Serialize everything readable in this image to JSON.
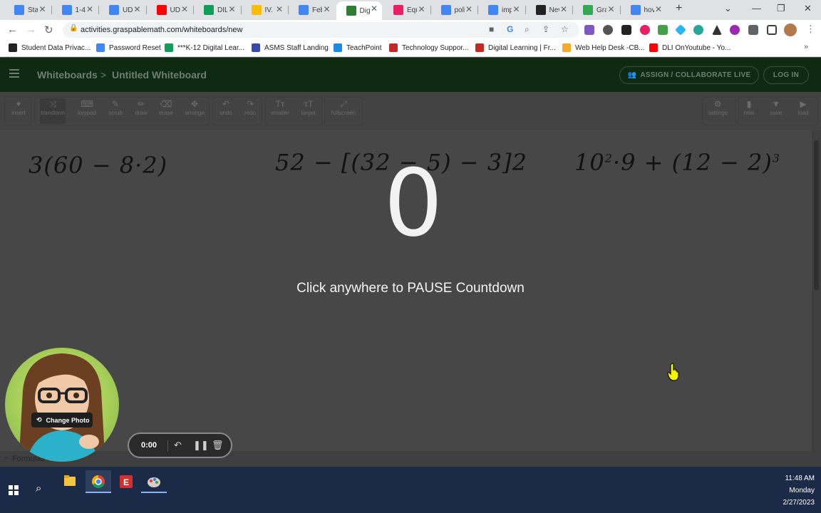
{
  "browser": {
    "tabs": [
      {
        "label": "Sta",
        "icon": "docs-icon",
        "color": "#4285f4"
      },
      {
        "label": "1-4",
        "icon": "docs-icon",
        "color": "#4285f4"
      },
      {
        "label": "UDI",
        "icon": "docs-icon",
        "color": "#4285f4"
      },
      {
        "label": "UDI",
        "icon": "youtube-icon",
        "color": "#ff0000"
      },
      {
        "label": "DIL",
        "icon": "meet-icon",
        "color": "#0f9d58"
      },
      {
        "label": "IV. I",
        "icon": "chart-icon",
        "color": "#fbbc04"
      },
      {
        "label": "Feb",
        "icon": "docs-icon",
        "color": "#4285f4"
      },
      {
        "label": "Dig",
        "icon": "graspable-icon",
        "color": "#2e7d32"
      },
      {
        "label": "Equ",
        "icon": "pink-shape-icon",
        "color": "#e91e63"
      },
      {
        "label": "poli",
        "icon": "google-icon",
        "color": "#4285f4"
      },
      {
        "label": "imp",
        "icon": "google-icon",
        "color": "#4285f4"
      },
      {
        "label": "Nev",
        "icon": "github-icon",
        "color": "#222222"
      },
      {
        "label": "Gra",
        "icon": "map-icon",
        "color": "#34a853"
      },
      {
        "label": "hov",
        "icon": "google-icon",
        "color": "#4285f4"
      }
    ],
    "active_tab_index": 7,
    "new_tab": "+",
    "url": "activities.graspablemath.com/whiteboards/new",
    "bookmarks": [
      {
        "label": "Student Data Privac...",
        "color": "#222222"
      },
      {
        "label": "Password Reset",
        "color": "#4285f4"
      },
      {
        "label": "***K-12 Digital Lear...",
        "color": "#0f9d58"
      },
      {
        "label": "ASMS Staff Landing",
        "color": "#3949ab"
      },
      {
        "label": "TeachPoint",
        "color": "#1e88e5"
      },
      {
        "label": "Technology Suppor...",
        "color": "#c62828"
      },
      {
        "label": "Digital Learning | Fr...",
        "color": "#c62828"
      },
      {
        "label": "Web Help Desk -CB...",
        "color": "#f9a825"
      },
      {
        "label": "DLI OnYoutube - Yo...",
        "color": "#ff0000"
      }
    ]
  },
  "app": {
    "breadcrumb_root": "Whiteboards",
    "breadcrumb_sep": ">",
    "breadcrumb_current": "Untitled Whiteboard",
    "assign_button": "ASSIGN / COLLABORATE LIVE",
    "login_button": "LOG IN",
    "tools_left": [
      {
        "label": "insert",
        "icon": "gear-icon",
        "glyph": "✦"
      },
      {
        "label": "transform",
        "icon": "shuffle-icon",
        "glyph": "⤨",
        "active": true
      },
      {
        "label": "keypad",
        "icon": "keyboard-icon",
        "glyph": "⌨"
      },
      {
        "label": "scrub",
        "icon": "wrench-icon",
        "glyph": "✎"
      },
      {
        "label": "draw",
        "icon": "pencil-icon",
        "glyph": "✏"
      },
      {
        "label": "erase",
        "icon": "eraser-icon",
        "glyph": "⌫"
      },
      {
        "label": "arrange",
        "icon": "move-icon",
        "glyph": "✥"
      },
      {
        "label": "undo",
        "icon": "undo-icon",
        "glyph": "↶"
      },
      {
        "label": "redo",
        "icon": "redo-icon",
        "glyph": "↷"
      },
      {
        "label": "smaller",
        "icon": "text-smaller-icon",
        "glyph": "Tт"
      },
      {
        "label": "larger",
        "icon": "text-larger-icon",
        "glyph": "тT"
      },
      {
        "label": "fullscreen",
        "icon": "fullscreen-icon",
        "glyph": "⤢"
      }
    ],
    "tools_right": [
      {
        "label": "settings",
        "icon": "gear-icon",
        "glyph": "⚙"
      },
      {
        "label": "new",
        "icon": "file-icon",
        "glyph": "▮"
      },
      {
        "label": "save",
        "icon": "save-icon",
        "glyph": "▼"
      },
      {
        "label": "load",
        "icon": "folder-icon",
        "glyph": "▶"
      }
    ]
  },
  "canvas": {
    "expr1": "3(60 − 8·2)",
    "expr2": "52 − [(32 − 5) − 3]2",
    "expr3_base": "10",
    "expr3_exp": "2",
    "expr3_mid": "·9 + (12 − 2)",
    "expr3_exp2": "3",
    "countdown": "0",
    "pause_text": "Click anywhere to PAUSE Countdown",
    "formulas_label": "Formulas"
  },
  "overlay": {
    "change_photo": "Change Photo",
    "recorder_time": "0:00"
  },
  "taskbar": {
    "time": "11:48 AM",
    "day": "Monday",
    "date": "2/27/2023"
  }
}
